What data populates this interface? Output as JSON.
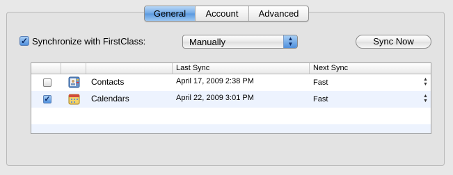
{
  "tabs": [
    {
      "label": "General",
      "selected": true
    },
    {
      "label": "Account",
      "selected": false
    },
    {
      "label": "Advanced",
      "selected": false
    }
  ],
  "sync": {
    "checkbox_checked": true,
    "label": "Synchronize with FirstClass:",
    "schedule_value": "Manually",
    "sync_now_label": "Sync Now"
  },
  "table": {
    "columns": [
      "",
      "",
      "",
      "Last Sync",
      "Next Sync"
    ],
    "rows": [
      {
        "checked": false,
        "icon": "contacts-icon",
        "name": "Contacts",
        "last_sync": "April 17, 2009 2:38 PM",
        "next_sync": "Fast"
      },
      {
        "checked": true,
        "icon": "calendars-icon",
        "name": "Calendars",
        "last_sync": "April 22, 2009 3:01 PM",
        "next_sync": "Fast"
      }
    ]
  },
  "colors": {
    "accent_blue": "#5a98de",
    "row_alt": "#edf3fe",
    "window_bg": "#e8e8e8"
  }
}
